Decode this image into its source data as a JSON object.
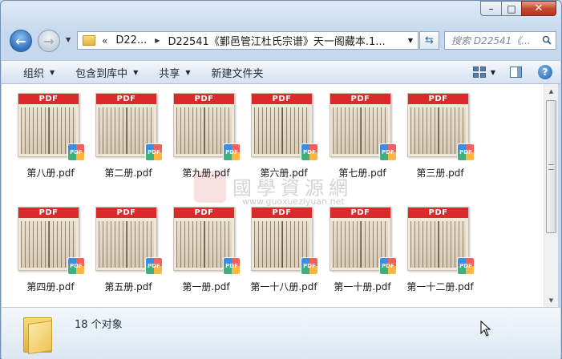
{
  "window": {
    "caption": {
      "minimize": "–",
      "maximize": "□",
      "close": "✕"
    }
  },
  "nav": {
    "back_icon": "arrow-left-icon",
    "forward_icon": "arrow-right-icon"
  },
  "address": {
    "chevron": "«",
    "segments": [
      "D22...",
      "D22541《鄞邑管江杜氏宗谱》天一阁藏本.1..."
    ]
  },
  "search": {
    "placeholder": "搜索 D22541《..."
  },
  "toolbar": {
    "organize": "组织",
    "include_in_library": "包含到库中",
    "share": "共享",
    "new_folder": "新建文件夹"
  },
  "files": [
    {
      "name": "第八册.pdf",
      "badge": "PDF"
    },
    {
      "name": "第二册.pdf",
      "badge": "PDF"
    },
    {
      "name": "第九册.pdf",
      "badge": "PDF"
    },
    {
      "name": "第六册.pdf",
      "badge": "PDF"
    },
    {
      "name": "第七册.pdf",
      "badge": "PDF"
    },
    {
      "name": "第三册.pdf",
      "badge": "PDF"
    },
    {
      "name": "第四册.pdf",
      "badge": "PDF"
    },
    {
      "name": "第五册.pdf",
      "badge": "PDF"
    },
    {
      "name": "第一册.pdf",
      "badge": "PDF"
    },
    {
      "name": "第一十八册.pdf",
      "badge": "PDF"
    },
    {
      "name": "第一十册.pdf",
      "badge": "PDF"
    },
    {
      "name": "第一十二册.pdf",
      "badge": "PDF"
    }
  ],
  "watermark": {
    "text": "國學資源網",
    "url": "www.guoxueziyuan.net"
  },
  "details": {
    "count": "18 个对象"
  },
  "colors": {
    "pdf_band": "#d92b2b",
    "selection_accent": "#3d8de0"
  }
}
